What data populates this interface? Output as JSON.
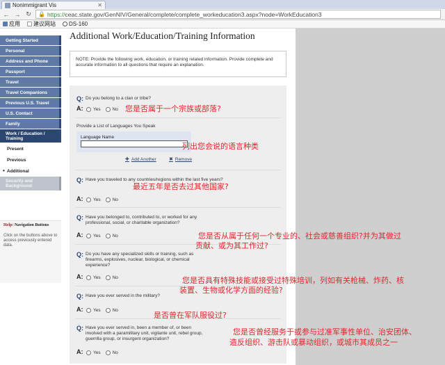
{
  "browser": {
    "tab_title": "Nonimmigrant Vis",
    "url_scheme": "https://",
    "url_rest": "ceac.state.gov/GenNIV/General/complete/complete_workeducation3.aspx?node=WorkEducation3",
    "bookmarks": [
      "应用",
      "建议网站",
      "DS-160"
    ]
  },
  "sidebar": {
    "items": [
      "Getting Started",
      "Personal",
      "Address and Phone",
      "Passport",
      "Travel",
      "Travel Companions",
      "Previous U.S. Travel",
      "U.S. Contact",
      "Family",
      "Work / Education / Training"
    ],
    "subitems": [
      "Present",
      "Previous",
      "Additional"
    ],
    "disabled_item": "Security and Background"
  },
  "help": {
    "title_prefix": "Help:",
    "title": "Navigation Buttons",
    "body": "Click on the buttons above to access previously entered data."
  },
  "page": {
    "title": "Additional Work/Education/Training Information",
    "note": "NOTE: Provide the following work, education, or training related information. Provide complete and accurate information to all questions that require an explanation."
  },
  "labels": {
    "q": "Q:",
    "a": "A:",
    "yes": "Yes",
    "no": "No"
  },
  "questions": [
    "Do you belong to a clan or tribe?",
    "Have you traveled to any countries/regions within the last five years?",
    "Have you belonged to, contributed to, or worked for any professional, social, or charitable organization?",
    "Do you have any specialized skills or training, such as firearms, explosives, nuclear, biological, or chemical experience?",
    "Have you ever served in the military?",
    "Have you ever served in, been a member of, or been involved with a paramilitary unit, vigilante unit, rebel group, guerrilla group, or insurgent organization?"
  ],
  "languages": {
    "section_title": "Provide a List of Languages You Speak",
    "field_label": "Language Name",
    "field_value": "",
    "add_label": "Add Another",
    "remove_label": "Remove"
  },
  "annotations": [
    "您是否属于一个宗族或部落?",
    "列出您会说的语言种类",
    "最近五年是否去过其他国家?",
    "您是否从属于任何一个专业的、社会或慈善组织?并为其做过",
    "贡献、或为其工作过?",
    "您是否具有特殊技能或接受过特殊培训，列如有关枪械、炸药、核",
    "装置、生物或化学方面的经验?",
    "是否曾在军队服役过?",
    "您是否曾经服务于或参与过准军事性单位、治安团体、",
    "造反组织、游击队或暴动组织，或城市其成员之一"
  ],
  "colors": {
    "sidebar": "#5f7aa6",
    "sidebar_active": "#2c4672",
    "annotation": "#e0282e"
  }
}
